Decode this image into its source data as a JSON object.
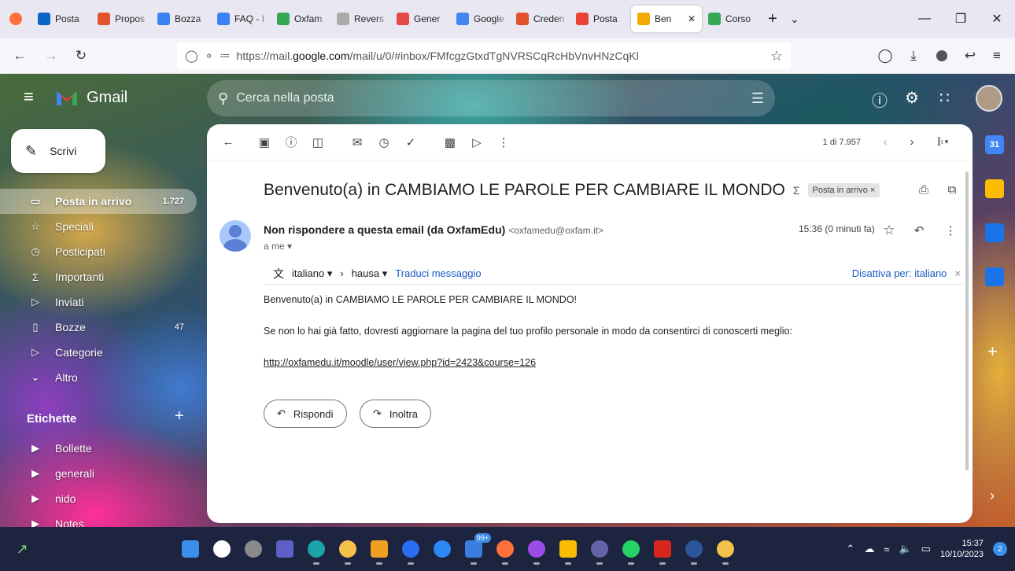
{
  "browser": {
    "tabs": [
      {
        "label": "Posta",
        "color": "#0a66c2"
      },
      {
        "label": "Propos",
        "color": "#e2532d"
      },
      {
        "label": "Bozza",
        "color": "#3b82f6"
      },
      {
        "label": "FAQ - I",
        "color": "#3b82f6"
      },
      {
        "label": "Oxfam",
        "color": "#34a853"
      },
      {
        "label": "Revers",
        "color": "#aaaaaa"
      },
      {
        "label": "Gener",
        "color": "#e54848"
      },
      {
        "label": "Google",
        "color": "#4285f4"
      },
      {
        "label": "Creden",
        "color": "#e2532d"
      },
      {
        "label": "Posta",
        "color": "#ea4335"
      },
      {
        "label": "Ben",
        "color": "#f2a900",
        "active": true
      },
      {
        "label": "Corso",
        "color": "#34a853"
      }
    ],
    "new_tab": "+",
    "tab_list": "⌄",
    "url": {
      "prefix": "https://mail.",
      "domain": "google.com",
      "path": "/mail/u/0/#inbox/FMfcgzGtxdTgNVRSCqRcHbVnvHNzCqKl"
    }
  },
  "gmail": {
    "brand": "Gmail",
    "search_placeholder": "Cerca nella posta",
    "compose_label": "Scrivi",
    "nav": [
      {
        "label": "Posta in arrivo",
        "count": "1.727",
        "icon": "inbox-icon",
        "glyph": "▭",
        "selected": true
      },
      {
        "label": "Speciali",
        "count": "",
        "icon": "star-icon",
        "glyph": "☆"
      },
      {
        "label": "Posticipati",
        "count": "",
        "icon": "clock-icon",
        "glyph": "◷"
      },
      {
        "label": "Importanti",
        "count": "",
        "icon": "important-icon",
        "glyph": "Σ"
      },
      {
        "label": "Inviati",
        "count": "",
        "icon": "send-icon",
        "glyph": "▷"
      },
      {
        "label": "Bozze",
        "count": "47",
        "icon": "draft-icon",
        "glyph": "▯"
      },
      {
        "label": "Categorie",
        "count": "",
        "icon": "label-icon",
        "glyph": "▷"
      },
      {
        "label": "Altro",
        "count": "",
        "icon": "chevron-down-icon",
        "glyph": "⌄"
      }
    ],
    "labels_title": "Etichette",
    "labels": [
      {
        "label": "Bollette"
      },
      {
        "label": "generali"
      },
      {
        "label": "nido"
      },
      {
        "label": "Notes"
      }
    ],
    "pagination": "1 di 7.957",
    "input_tools": "I",
    "message": {
      "subject": "Benvenuto(a) in CAMBIAMO LE PAROLE PER CAMBIARE IL MONDO",
      "folder_chip": "Posta in arrivo",
      "sender_name": "Non rispondere a questa email (da OxfamEdu)",
      "sender_email": "<oxfamedu@oxfam.it>",
      "time": "15:36 (0 minuti fa)",
      "to": "a me",
      "translate": {
        "from": "italiano",
        "to": "hausa",
        "action": "Traduci messaggio",
        "disable": "Disattiva per: italiano"
      },
      "body_line1": "Benvenuto(a) in CAMBIAMO LE PAROLE PER CAMBIARE IL MONDO!",
      "body_line2": "Se non lo hai già fatto, dovresti aggiornare la pagina del tuo profilo personale in modo da consentirci di conoscerti meglio:",
      "link": "http://oxfamedu.it/moodle/user/view.php?id=2423&course=126",
      "reply_label": "Rispondi",
      "forward_label": "Inoltra"
    }
  },
  "side_panel": [
    {
      "icon": "calendar-icon",
      "label": "31",
      "color": "#4285f4"
    },
    {
      "icon": "keep-icon",
      "label": "",
      "color": "#fbbc04"
    },
    {
      "icon": "tasks-icon",
      "label": "",
      "color": "#1a73e8"
    },
    {
      "icon": "contacts-icon",
      "label": "",
      "color": "#1a73e8"
    }
  ],
  "taskbar": {
    "apps": [
      {
        "icon": "windows-start-icon",
        "color": "#3b8eea"
      },
      {
        "icon": "search-icon",
        "color": "#ffffff"
      },
      {
        "icon": "task-view-icon",
        "color": "#8a8a8a"
      },
      {
        "icon": "chat-icon",
        "color": "#5b5fc7"
      },
      {
        "icon": "edge-icon",
        "color": "#1aa3a8"
      },
      {
        "icon": "file-explorer-icon",
        "color": "#f5c14b"
      },
      {
        "icon": "store-icon",
        "color": "#f0a020"
      },
      {
        "icon": "app-icon",
        "color": "#2a6df4"
      },
      {
        "icon": "todo-icon",
        "color": "#2b88f5"
      },
      {
        "icon": "mail-icon",
        "color": "#3a7de0",
        "badge": "99+"
      },
      {
        "icon": "firefox-icon",
        "color": "#ff7139"
      },
      {
        "icon": "app-2-icon",
        "color": "#9d4be6"
      },
      {
        "icon": "chrome-icon",
        "color": "#fbbc04"
      },
      {
        "icon": "teams-icon",
        "color": "#6264a7"
      },
      {
        "icon": "whatsapp-icon",
        "color": "#25d366"
      },
      {
        "icon": "acrobat-icon",
        "color": "#d9261c"
      },
      {
        "icon": "word-icon",
        "color": "#2b579a"
      },
      {
        "icon": "app-3-icon",
        "color": "#f2c14e"
      }
    ],
    "time": "15:37",
    "date": "10/10/2023",
    "notification_count": "2"
  }
}
